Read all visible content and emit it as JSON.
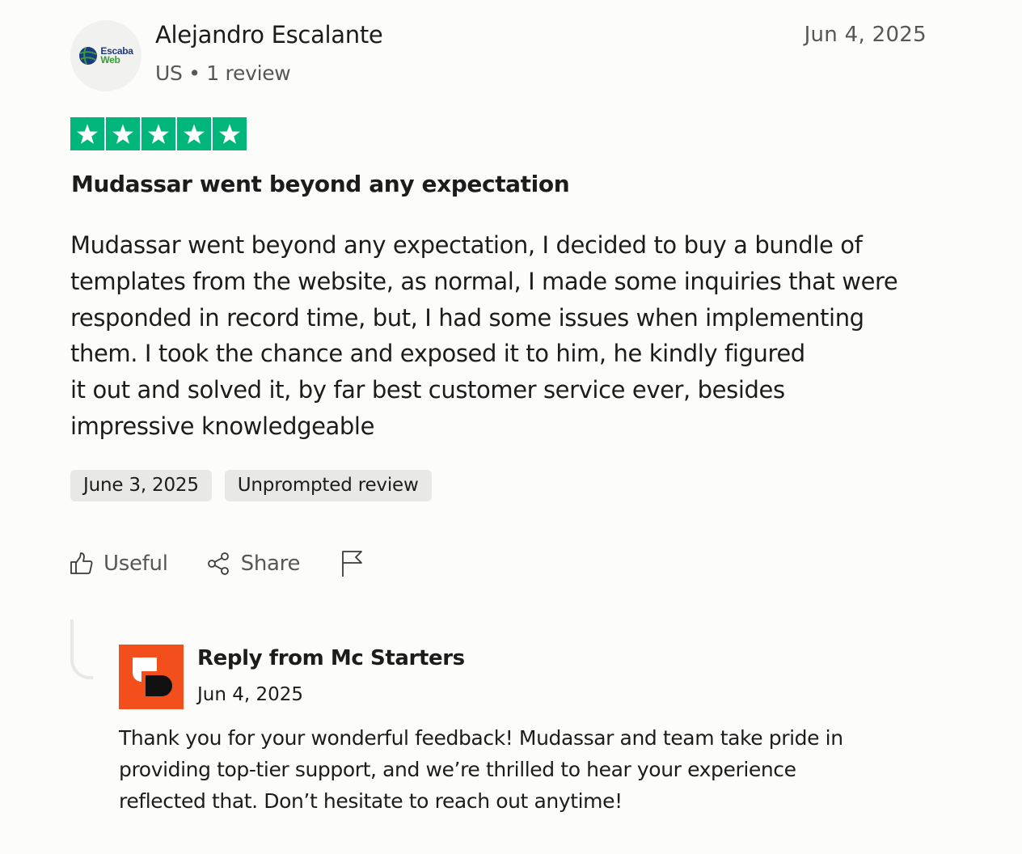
{
  "reviewer": {
    "avatar_logo_top": "Escaba",
    "avatar_logo_bottom": "Web",
    "name": "Alejandro Escalante",
    "meta": "US • 1 review"
  },
  "review": {
    "date": "Jun 4, 2025",
    "rating": 5,
    "rating_max": 5,
    "star_color": "#00b67a",
    "title": "Mudassar went beyond any expectation",
    "body_lines": [
      "Mudassar went beyond any expectation, I decided to buy a bundle of",
      "templates from the website, as normal, I made some inquiries that were",
      "responded in record time, but, I had some issues when implementing",
      "them. I took the chance and exposed it to him, he kindly figured",
      "it out and solved it, by far best customer service ever, besides",
      "impressive knowledgeable"
    ],
    "tags": [
      "June 3, 2025",
      "Unprompted review"
    ]
  },
  "actions": {
    "useful_label": "Useful",
    "share_label": "Share",
    "icons": [
      "thumbs-up-icon",
      "share-icon",
      "flag-icon"
    ]
  },
  "reply": {
    "title": "Reply from Mc Starters",
    "date": "Jun 4, 2025",
    "logo_color": "#f24f1d",
    "body_lines": [
      "Thank you for your wonderful feedback! Mudassar and team take pride in",
      "providing top-tier support, and we’re thrilled to hear your experience",
      "reflected that. Don’t hesitate to reach out anytime!"
    ]
  }
}
